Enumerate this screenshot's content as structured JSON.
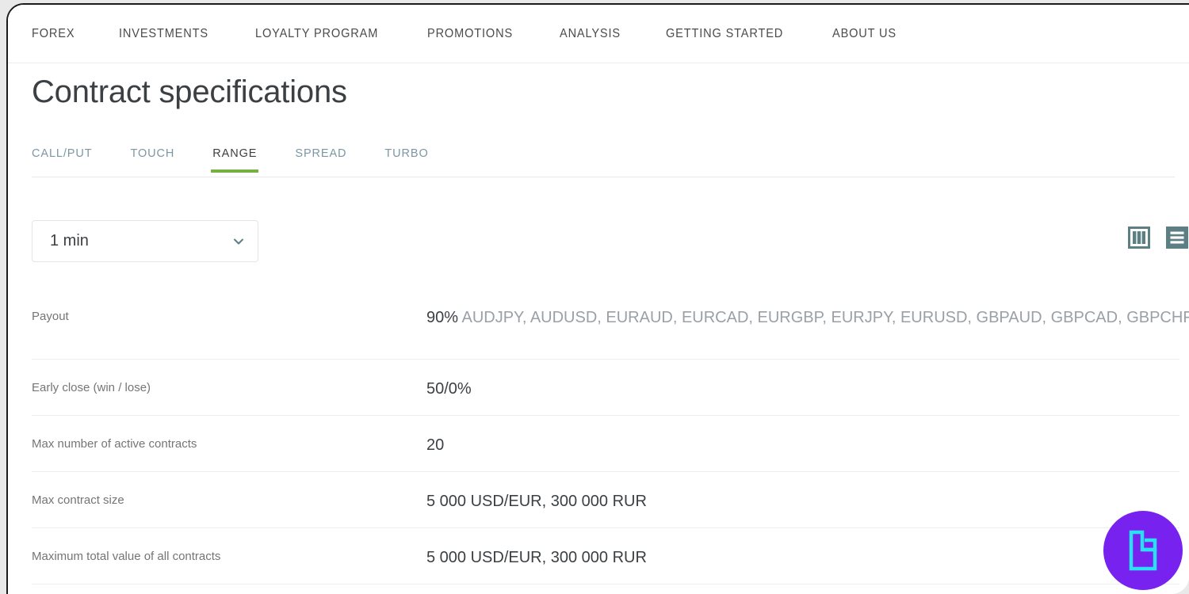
{
  "window": {
    "background_color": "#e9e9e9",
    "page_background": "#ffffff"
  },
  "topnav": {
    "items": [
      {
        "label": "FOREX"
      },
      {
        "label": "INVESTMENTS"
      },
      {
        "label": "LOYALTY PROGRAM"
      },
      {
        "label": "PROMOTIONS"
      },
      {
        "label": "ANALYSIS"
      },
      {
        "label": "GETTING STARTED"
      },
      {
        "label": "ABOUT US"
      }
    ]
  },
  "header": {
    "title": "Contract specifications"
  },
  "tabs": {
    "active_index": 2,
    "active_underline_color": "#76b043",
    "inactive_color": "#7c97a3",
    "items": [
      {
        "label": "CALL/PUT",
        "active": false
      },
      {
        "label": "TOUCH",
        "active": false
      },
      {
        "label": "RANGE",
        "active": true
      },
      {
        "label": "SPREAD",
        "active": false
      },
      {
        "label": "TURBO",
        "active": false
      }
    ]
  },
  "controls": {
    "duration_select": {
      "value": "1 min",
      "placeholder": "1 min",
      "icon": "chevron-down-icon",
      "options": [
        "1 min"
      ]
    },
    "view_toggles": [
      {
        "name": "columns-view-icon",
        "label": "Columns view",
        "active": false,
        "color": "#5c7f83"
      },
      {
        "name": "list-view-icon",
        "label": "List view",
        "active": true,
        "color": "#5c7f83"
      }
    ]
  },
  "spec_table": {
    "rows": [
      {
        "label": "Payout",
        "value_prefix": "90%",
        "value_list": " AUDJPY, AUDUSD, EURAUD, EURCAD, EURGBP, EURJPY, EURUSD, GBPAUD, GBPCAD, GBPCHF, GBPJPY, GBPUSD, NZDJPY, NZDUSD, USDCAD, USDCHF, USDJPY, XAGUSD, XAUUSD"
      },
      {
        "label": "Early close (win / lose)",
        "value": "50/0%"
      },
      {
        "label": "Max number of active contracts",
        "value": "20"
      },
      {
        "label": "Max contract size",
        "value": "5 000 USD/EUR, 300 000 RUR"
      },
      {
        "label": "Maximum total value of all contracts",
        "value": "5 000 USD/EUR, 300 000 RUR"
      }
    ]
  },
  "watermark": {
    "name": "lc-monogram-logo",
    "badge_color": "#7722ee",
    "mark_color": "#2ae0f5"
  }
}
